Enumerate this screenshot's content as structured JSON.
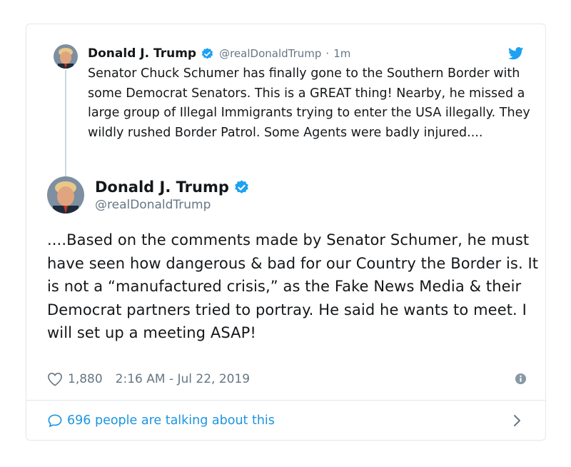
{
  "parent_tweet": {
    "name": "Donald J. Trump",
    "handle": "@realDonaldTrump",
    "separator": "·",
    "time": "1m",
    "text": "Senator Chuck Schumer has finally gone to the Southern Border with some Democrat Senators. This is a GREAT thing! Nearby, he missed a large group of Illegal Immigrants trying to enter the USA illegally. They wildly rushed Border Patrol. Some Agents were badly injured...."
  },
  "main_tweet": {
    "name": "Donald J. Trump",
    "handle": "@realDonaldTrump",
    "text": "....Based on the comments made by Senator Schumer, he must have seen how dangerous & bad for our Country the Border is. It is not a “manufactured crisis,” as the Fake News Media & their Democrat partners tried to portray. He said he wants to meet. I will set up a meeting ASAP!",
    "likes": "1,880",
    "timestamp": "2:16 AM - Jul 22, 2019"
  },
  "footer": {
    "label": "696 people are talking about this"
  },
  "icons": {
    "verified": "verified-badge-icon",
    "bird": "twitter-bird-icon",
    "like": "heart-icon",
    "info": "info-icon",
    "reply": "speech-bubble-icon",
    "chevron": "chevron-right-icon"
  },
  "colors": {
    "twitter_blue": "#1da1f2",
    "link_blue": "#1b95e0",
    "secondary_text": "#657786",
    "primary_text": "#14171a",
    "border": "#e1e8ed"
  }
}
